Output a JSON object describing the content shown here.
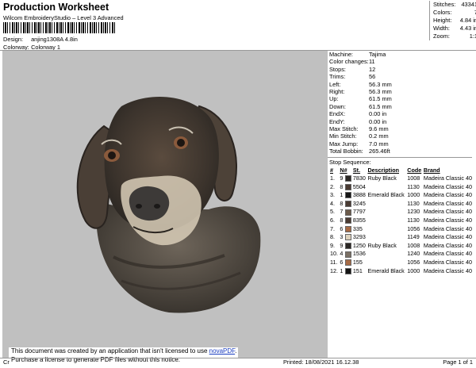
{
  "header": {
    "title": "Production Worksheet",
    "subtitle": "Wilcom EmbroideryStudio – Level 3 Advanced",
    "design_label": "Design:",
    "design_value": "anjing1308A 4.8in",
    "colorway_label": "Colorway:",
    "colorway_value": "Colorway 1"
  },
  "summary": [
    {
      "k": "Stitches:",
      "v": "43341"
    },
    {
      "k": "Colors:",
      "v": "7"
    },
    {
      "k": "Height:",
      "v": "4.84 in"
    },
    {
      "k": "Width:",
      "v": "4.43 in"
    },
    {
      "k": "Zoom:",
      "v": "1:1"
    }
  ],
  "info": [
    {
      "k": "Machine:",
      "v": "Tajima"
    },
    {
      "k": "Color changes:",
      "v": "11"
    },
    {
      "k": "Stops:",
      "v": "12"
    },
    {
      "k": "Trims:",
      "v": "56"
    },
    {
      "k": "Left:",
      "v": "56.3 mm"
    },
    {
      "k": "Right:",
      "v": "56.3 mm"
    },
    {
      "k": "Up:",
      "v": "61.5 mm"
    },
    {
      "k": "Down:",
      "v": "61.5 mm"
    },
    {
      "k": "EndX:",
      "v": "0.00 in"
    },
    {
      "k": "EndY:",
      "v": "0.00 in"
    },
    {
      "k": "Max Stitch:",
      "v": "9.6 mm"
    },
    {
      "k": "Min Stitch:",
      "v": "0.2 mm"
    },
    {
      "k": "Max Jump:",
      "v": "7.0 mm"
    },
    {
      "k": "Total Bobbin:",
      "v": "265.46ft"
    }
  ],
  "stop_sequence": {
    "label": "Stop Sequence:",
    "columns": [
      "#",
      "N#",
      "St.",
      "Description",
      "Code",
      "Brand"
    ],
    "rows": [
      {
        "n": "1.",
        "needle": "9",
        "color": "#2b2825",
        "st": "7830",
        "desc": "Ruby Black",
        "code": "1008",
        "brand": "Madeira Classic 40"
      },
      {
        "n": "2.",
        "needle": "8",
        "color": "#4a3b33",
        "st": "5504",
        "desc": "",
        "code": "1130",
        "brand": "Madeira Classic 40"
      },
      {
        "n": "3.",
        "needle": "1",
        "color": "#151515",
        "st": "3888",
        "desc": "Emerald Black",
        "code": "1000",
        "brand": "Madeira Classic 40"
      },
      {
        "n": "4.",
        "needle": "8",
        "color": "#4a3b33",
        "st": "3245",
        "desc": "",
        "code": "1130",
        "brand": "Madeira Classic 40"
      },
      {
        "n": "5.",
        "needle": "7",
        "color": "#6b5a4a",
        "st": "7797",
        "desc": "",
        "code": "1230",
        "brand": "Madeira Classic 40"
      },
      {
        "n": "6.",
        "needle": "8",
        "color": "#4a3b33",
        "st": "8355",
        "desc": "",
        "code": "1130",
        "brand": "Madeira Classic 40"
      },
      {
        "n": "7.",
        "needle": "6",
        "color": "#a66a45",
        "st": "335",
        "desc": "",
        "code": "1056",
        "brand": "Madeira Classic 40"
      },
      {
        "n": "8.",
        "needle": "3",
        "color": "#ddd2bd",
        "st": "3293",
        "desc": "",
        "code": "1149",
        "brand": "Madeira Classic 40"
      },
      {
        "n": "9.",
        "needle": "9",
        "color": "#2b2825",
        "st": "1250",
        "desc": "Ruby Black",
        "code": "1008",
        "brand": "Madeira Classic 40"
      },
      {
        "n": "10.",
        "needle": "4",
        "color": "#7a7064",
        "st": "1536",
        "desc": "",
        "code": "1240",
        "brand": "Madeira Classic 40"
      },
      {
        "n": "11.",
        "needle": "6",
        "color": "#a66a45",
        "st": "155",
        "desc": "",
        "code": "1056",
        "brand": "Madeira Classic 40"
      },
      {
        "n": "12.",
        "needle": "1",
        "color": "#151515",
        "st": "151",
        "desc": "Emerald Black",
        "code": "1000",
        "brand": "Madeira Classic 40"
      }
    ]
  },
  "notice": {
    "line1_pre": "This document was created by an application that isn't licensed to use ",
    "link": "novaPDF",
    "line1_post": ".",
    "line2": "Purchase a license to generate PDF files without this notice."
  },
  "footer": {
    "left": "Cr",
    "printed": "Printed: 18/08/2021 16.12.38",
    "page": "Page 1 of 1"
  }
}
